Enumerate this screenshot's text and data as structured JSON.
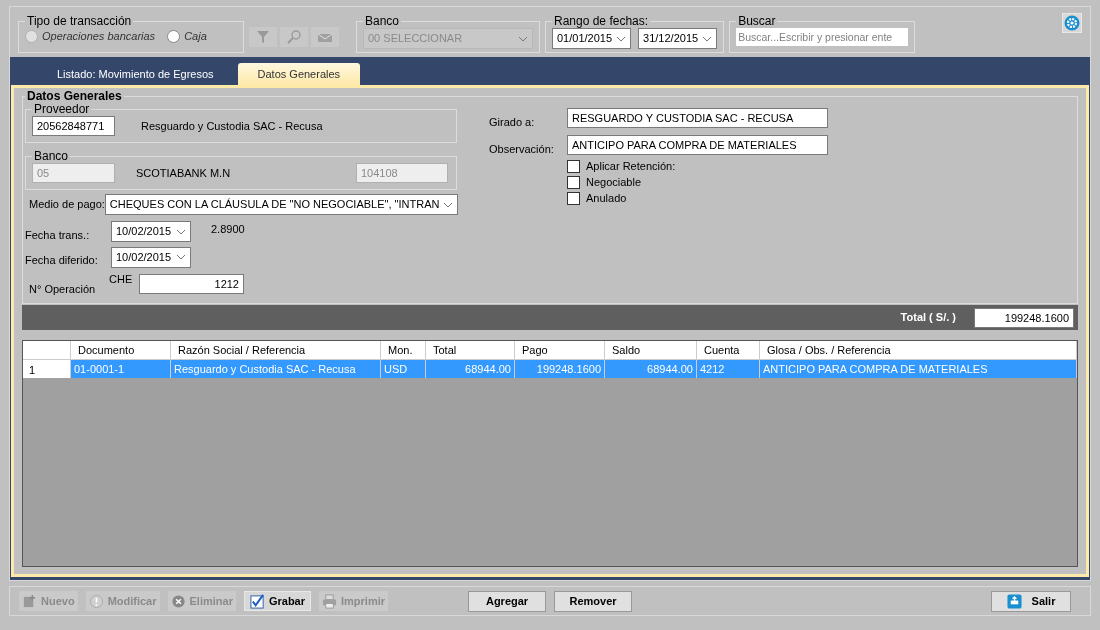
{
  "transaction_type": {
    "label": "Tipo de transacción",
    "options": [
      {
        "label": "Operaciones bancarias",
        "selected": false,
        "disabled": true
      },
      {
        "label": "Caja",
        "selected": false,
        "disabled": false
      }
    ]
  },
  "bank_filter": {
    "label": "Banco",
    "value": "00 SELECCIONAR"
  },
  "date_range": {
    "label": "Rango de fechas:",
    "from": "01/01/2015",
    "to": "31/12/2015"
  },
  "search": {
    "label": "Buscar",
    "placeholder": "Buscar...Escribir y presionar ente"
  },
  "tabs": [
    {
      "label": "Listado: Movimiento de Egresos",
      "selected": false
    },
    {
      "label": "Datos Generales",
      "selected": true
    }
  ],
  "general": {
    "title": "Datos Generales",
    "proveedor": {
      "label": "Proveedor",
      "code": "20562848771",
      "name": "Resguardo y Custodia SAC - Recusa"
    },
    "banco": {
      "label": "Banco",
      "code": "05",
      "name": "SCOTIABANK M.N",
      "account": "104108"
    },
    "medio_pago": {
      "label": "Medio de pago:",
      "value": "CHEQUES CON LA CLÁUSULA DE \"NO NEGOCIABLE\", \"INTRAN"
    },
    "fecha_trans": {
      "label": "Fecha trans.:",
      "value": "10/02/2015"
    },
    "rate": "2.8900",
    "fecha_diferido": {
      "label": "Fecha diferido:",
      "value": "10/02/2015"
    },
    "operacion": {
      "label": "N° Operación",
      "prefix": "CHE",
      "value": "1212"
    },
    "girado": {
      "label": "Girado a:",
      "value": "RESGUARDO Y CUSTODIA SAC - RECUSA"
    },
    "observacion": {
      "label": "Observación:",
      "value": "ANTICIPO PARA COMPRA DE MATERIALES"
    },
    "checks": [
      {
        "label": "Aplicar Retención:",
        "checked": false
      },
      {
        "label": "Negociable",
        "checked": false
      },
      {
        "label": "Anulado",
        "checked": false
      }
    ]
  },
  "total": {
    "label": "Total ( S/. )",
    "value": "199248.1600"
  },
  "table": {
    "columns": [
      "Documento",
      "Razón Social / Referencia",
      "Mon.",
      "Total",
      "Pago",
      "Saldo",
      "Cuenta",
      "Glosa / Obs. / Referencia"
    ],
    "rows": [
      {
        "number": "1",
        "selected": true,
        "cells": [
          "01-0001-1",
          "Resguardo y Custodia SAC - Recusa",
          "USD",
          "68944.00",
          "199248.1600",
          "68944.00",
          "4212",
          "ANTICIPO PARA COMPRA DE MATERIALES"
        ]
      }
    ]
  },
  "actions": [
    {
      "label": "Nuevo",
      "kind": "new",
      "disabled": true
    },
    {
      "label": "Modificar",
      "kind": "edit",
      "disabled": true
    },
    {
      "label": "Eliminar",
      "kind": "delete",
      "disabled": true
    },
    {
      "label": "Grabar",
      "kind": "save",
      "disabled": false
    },
    {
      "label": "Imprimir",
      "kind": "print",
      "disabled": true
    }
  ],
  "row_buttons": [
    "Agregar",
    "Remover"
  ],
  "exit_button": "Salir"
}
